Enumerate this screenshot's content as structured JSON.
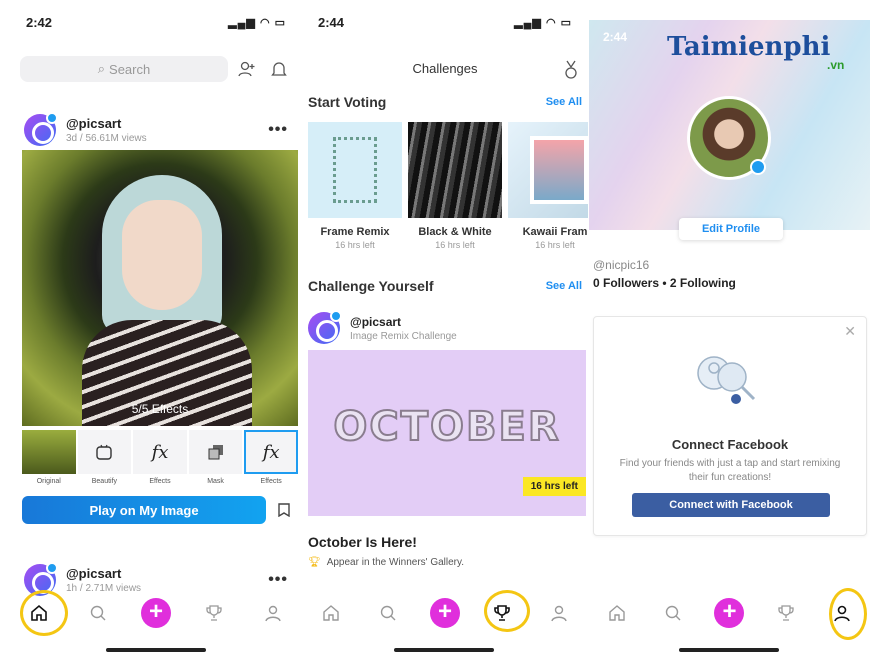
{
  "colors": {
    "accent_blue": "#1f8ef0",
    "plus_magenta": "#e02fdc",
    "highlight_yellow": "#f4c613",
    "facebook_blue": "#3b5ea2",
    "badge_yellow": "#fbe724"
  },
  "panel1": {
    "time": "2:42",
    "search_placeholder": "Search",
    "post1": {
      "username": "@picsart",
      "meta": "3d / 56.61M views",
      "effects_overlay": "5/5 Effects"
    },
    "tools": [
      {
        "label": "Original",
        "icon": "original-thumbnail"
      },
      {
        "label": "Beautify",
        "icon": "beautify-icon"
      },
      {
        "label": "Effects",
        "glyph": "fx"
      },
      {
        "label": "Mask",
        "icon": "mask-icon"
      },
      {
        "label": "Effects",
        "glyph": "fx"
      }
    ],
    "play_button": "Play on My Image",
    "post2": {
      "username": "@picsart",
      "meta": "1h / 2.71M views"
    }
  },
  "panel2": {
    "time": "2:44",
    "title": "Challenges",
    "start_voting": {
      "heading": "Start Voting",
      "see_all": "See All"
    },
    "cards": [
      {
        "name": "Frame Remix",
        "time": "16 hrs left"
      },
      {
        "name": "Black & White",
        "time": "16 hrs left"
      },
      {
        "name": "Kawaii Fram",
        "time": "16 hrs left"
      }
    ],
    "challenge_yourself": {
      "heading": "Challenge Yourself",
      "see_all": "See All"
    },
    "challenge_post": {
      "username": "@picsart",
      "subtitle": "Image Remix Challenge"
    },
    "october_word": "OCTOBER",
    "badge": "16 hrs left",
    "october_title": "October Is Here!",
    "october_sub": "Appear in the Winners' Gallery."
  },
  "panel3": {
    "time": "2:44",
    "watermark": "Taimienphi",
    "watermark_suffix": ".vn",
    "edit_profile": "Edit Profile",
    "username": "@nicpic16",
    "follow_stats": "0 Followers • 2 Following",
    "connect_title": "Connect Facebook",
    "connect_desc": "Find your friends with just a tap and start remixing their fun creations!",
    "connect_button": "Connect with Facebook"
  }
}
